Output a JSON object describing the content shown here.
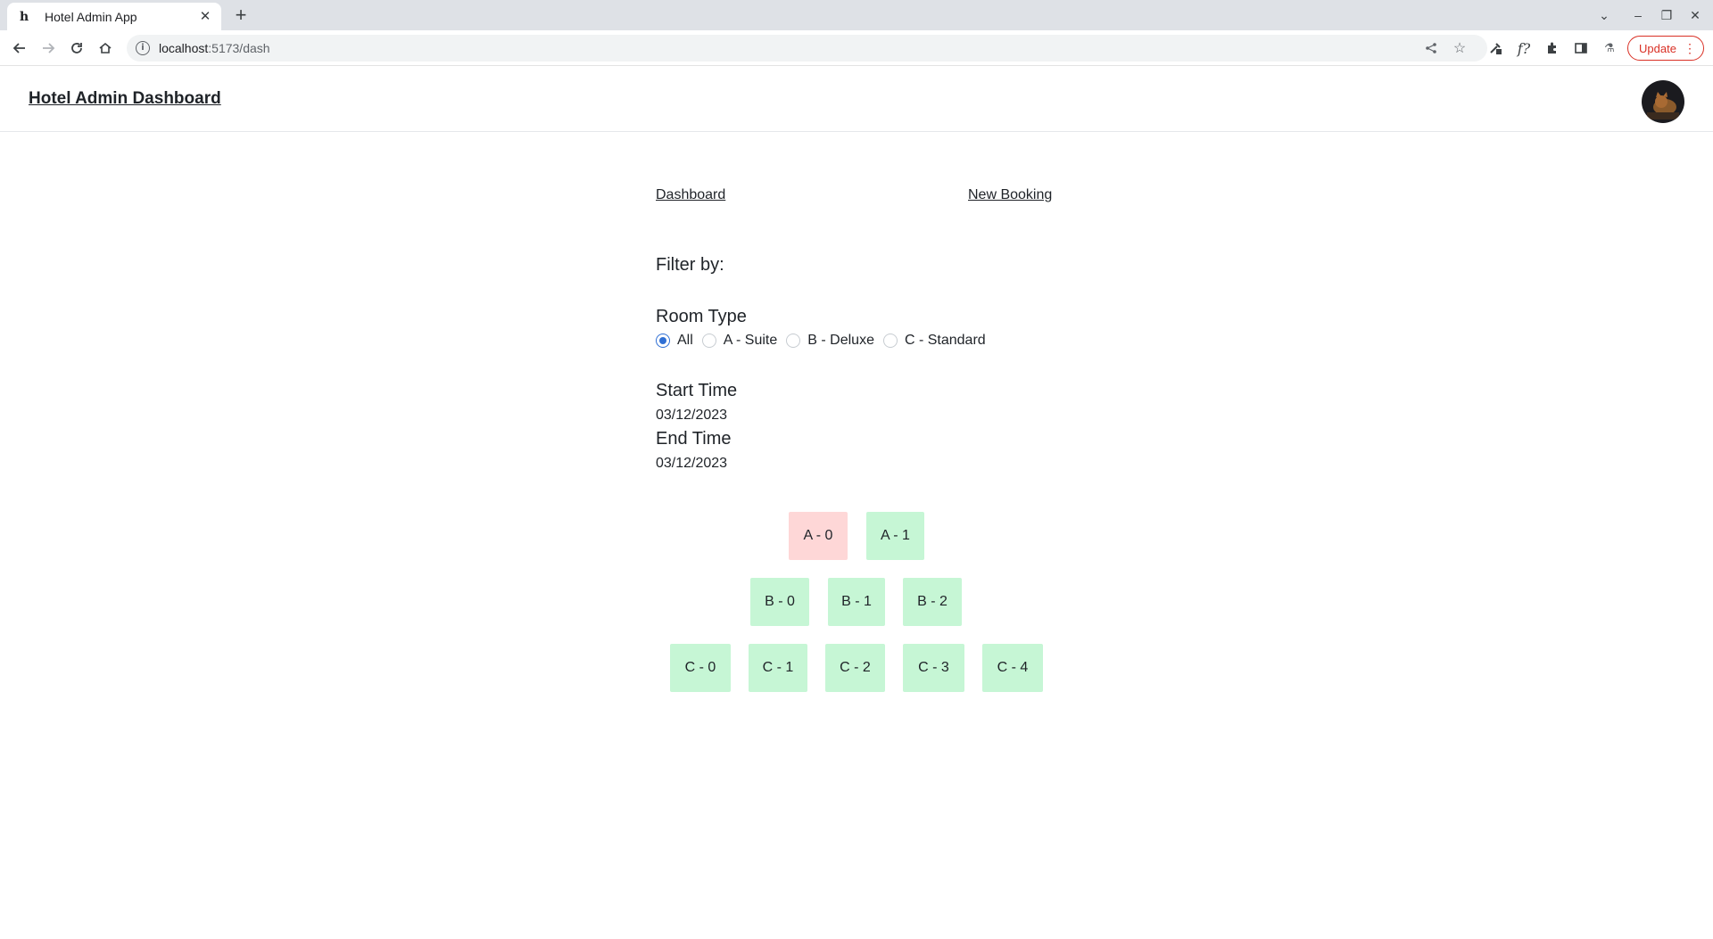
{
  "browser": {
    "tab_title": "Hotel Admin App",
    "tab_favicon": "h",
    "url_host": "localhost",
    "url_path": ":5173/dash",
    "update_label": "Update"
  },
  "header": {
    "title": "Hotel Admin Dashboard"
  },
  "nav": {
    "dashboard": "Dashboard",
    "new_booking": "New Booking"
  },
  "filter": {
    "heading": "Filter by:",
    "room_type_label": "Room Type",
    "room_type_options": [
      {
        "label": "All",
        "checked": true
      },
      {
        "label": "A - Suite",
        "checked": false
      },
      {
        "label": "B - Deluxe",
        "checked": false
      },
      {
        "label": "C - Standard",
        "checked": false
      }
    ],
    "start_time_label": "Start Time",
    "start_time_value": "03/12/2023",
    "end_time_label": "End Time",
    "end_time_value": "03/12/2023"
  },
  "rooms": {
    "rows": [
      [
        {
          "label": "A - 0",
          "status": "booked"
        },
        {
          "label": "A - 1",
          "status": "available"
        }
      ],
      [
        {
          "label": "B - 0",
          "status": "available"
        },
        {
          "label": "B - 1",
          "status": "available"
        },
        {
          "label": "B - 2",
          "status": "available"
        }
      ],
      [
        {
          "label": "C - 0",
          "status": "available"
        },
        {
          "label": "C - 1",
          "status": "available"
        },
        {
          "label": "C - 2",
          "status": "available"
        },
        {
          "label": "C - 3",
          "status": "available"
        },
        {
          "label": "C - 4",
          "status": "available"
        }
      ]
    ]
  },
  "colors": {
    "available": "#c6f6d5",
    "booked": "#fed7d7",
    "radio_accent": "#2f6fd4",
    "update_red": "#d93025"
  }
}
